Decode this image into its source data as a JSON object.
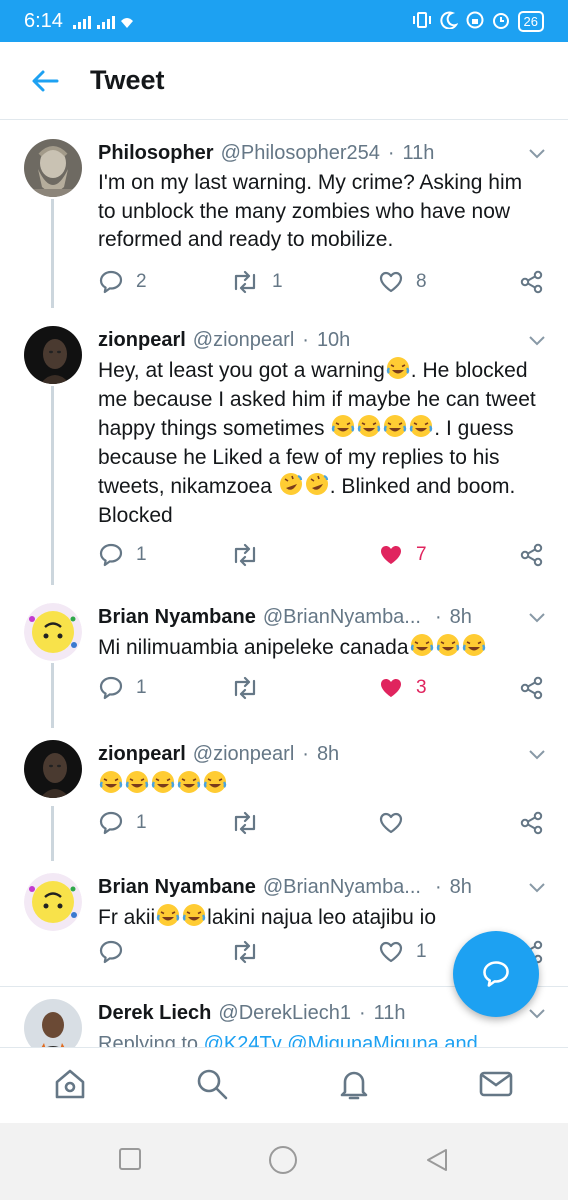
{
  "status_bar": {
    "time": "6:14",
    "battery": "26"
  },
  "header": {
    "title": "Tweet"
  },
  "tweets": [
    {
      "name": "Philosopher",
      "handle": "@Philosopher254",
      "sep": "·",
      "time": "11h",
      "text": "I'm on my last warning. My crime? Asking him to unblock the many zombies who have now reformed and ready to mobilize.",
      "replies": "2",
      "retweets": "1",
      "likes": "8"
    },
    {
      "name": "zionpearl",
      "handle": "@zionpearl",
      "sep": "·",
      "time": "10h",
      "text_1": "Hey, at least you got a warning",
      "text_2": ". He blocked me because I asked him if maybe he can tweet happy things sometimes ",
      "text_3": ". I guess because he Liked a few of my replies to his tweets, nikamzoea ",
      "text_4": ". Blinked and boom. Blocked",
      "replies": "1",
      "retweets": "",
      "likes": "7"
    },
    {
      "name": "Brian Nyambane",
      "handle": "@BrianNyamba...",
      "sep": "·",
      "time": "8h",
      "text": "Mi nilimuambia anipeleke canada",
      "replies": "1",
      "retweets": "",
      "likes": "3"
    },
    {
      "name": "zionpearl",
      "handle": "@zionpearl",
      "sep": "·",
      "time": "8h",
      "text": "",
      "replies": "1",
      "retweets": "",
      "likes": ""
    },
    {
      "name": "Brian Nyambane",
      "handle": "@BrianNyamba...",
      "sep": "·",
      "time": "8h",
      "text_1": "Fr akii",
      "text_2": "lakini najua leo atajibu io",
      "replies": "",
      "retweets": "",
      "likes": "1"
    },
    {
      "name": "Derek Liech",
      "handle": "@DerekLiech1",
      "sep": "·",
      "time": "11h",
      "reply_prefix": "Replying to ",
      "reply_to": "@K24Tv @MigunaMiguna and"
    }
  ],
  "colors": {
    "accent": "#1da1f2",
    "like": "#e0245e",
    "secondary": "#657786"
  },
  "icons": [
    "back-arrow-icon",
    "reply-icon",
    "retweet-icon",
    "heart-icon",
    "share-icon",
    "chevron-down-icon",
    "compose-icon",
    "home-icon",
    "search-icon",
    "notifications-icon",
    "messages-icon"
  ]
}
